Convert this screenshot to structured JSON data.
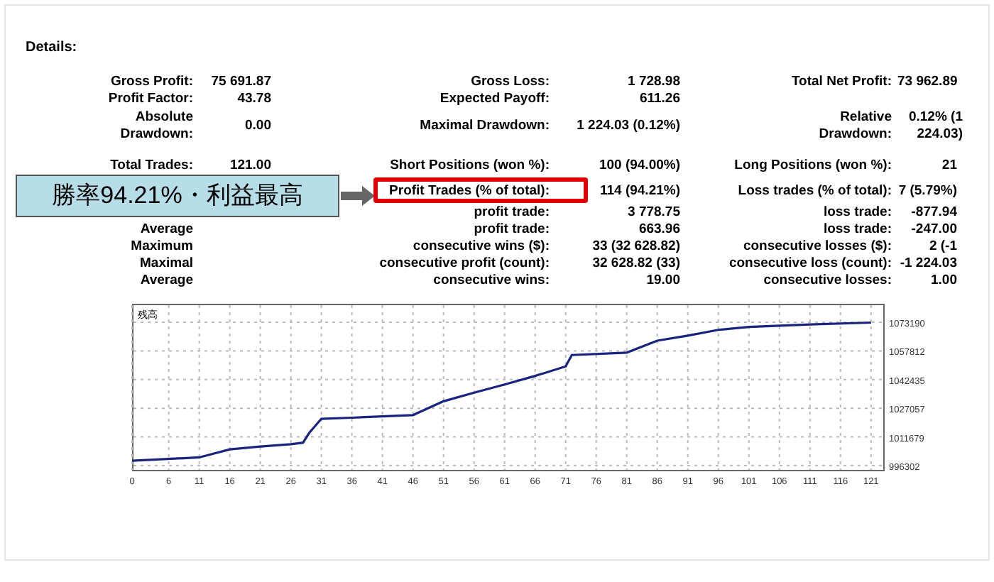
{
  "heading": "Details:",
  "stats": [
    {
      "left": {
        "label": "Gross Profit:",
        "value": "75 691.87"
      },
      "middle": {
        "label": "Gross Loss:",
        "value": "1 728.98"
      },
      "right": {
        "label": "Total Net Profit:",
        "value": "73 962.89"
      }
    },
    {
      "left": {
        "label": "Profit Factor:",
        "value": "43.78"
      },
      "middle": {
        "label": "Expected Payoff:",
        "value": "611.26"
      }
    },
    {
      "left": {
        "label": "Absolute Drawdown:",
        "value": "0.00"
      },
      "middle": {
        "label": "Maximal Drawdown:",
        "value": "1 224.03 (0.12%)"
      },
      "right": {
        "label": "Relative Drawdown:",
        "value": "0.12% (1 224.03)"
      }
    },
    {
      "left": {
        "label": "Total Trades:",
        "value": "121.00"
      },
      "middle": {
        "label": "Short Positions (won %):",
        "value": "100 (94.00%)"
      },
      "right": {
        "label": "Long Positions (won %):",
        "value": "21"
      }
    },
    {
      "middle": {
        "label": "Profit Trades (% of total):",
        "value": "114 (94.21%)"
      },
      "right": {
        "label": "Loss trades (% of total):",
        "value": "7 (5.79%)"
      }
    },
    {
      "middle": {
        "label": "profit trade:",
        "value": "3 778.75"
      },
      "right": {
        "label": "loss trade:",
        "value": "-877.94"
      }
    },
    {
      "left": {
        "label": "Average"
      },
      "middle": {
        "label": "profit trade:",
        "value": "663.96"
      },
      "right": {
        "label": "loss trade:",
        "value": "-247.00"
      }
    },
    {
      "left": {
        "label": "Maximum"
      },
      "middle": {
        "label": "consecutive wins ($):",
        "value": "33 (32 628.82)"
      },
      "right": {
        "label": "consecutive losses ($):",
        "value": "2 (-1"
      }
    },
    {
      "left": {
        "label": "Maximal"
      },
      "middle": {
        "label": "consecutive profit (count):",
        "value": "32 628.82 (33)"
      },
      "right": {
        "label": "consecutive loss (count):",
        "value": "-1 224.03"
      }
    },
    {
      "left": {
        "label": "Average"
      },
      "middle": {
        "label": "consecutive wins:",
        "value": "19.00"
      },
      "right": {
        "label": "consecutive losses:",
        "value": "1.00"
      }
    }
  ],
  "callout": {
    "text": "勝率94.21%・利益最高"
  },
  "chart": {
    "chart_data": {
      "type": "line",
      "title": "残高",
      "x": [
        0,
        11,
        16,
        21,
        26,
        28,
        29,
        31,
        36,
        46,
        51,
        56,
        61,
        66,
        71,
        72,
        81,
        86,
        91,
        96,
        101,
        111,
        121
      ],
      "grid": true,
      "series": [
        {
          "color": "#1a237e",
          "values": [
            998900,
            1000700,
            1005000,
            1006500,
            1007800,
            1008600,
            1013800,
            1021400,
            1022000,
            1023400,
            1030800,
            1035400,
            1039800,
            1044400,
            1049500,
            1055600,
            1056900,
            1063300,
            1066000,
            1069100,
            1070700,
            1072000,
            1073000
          ]
        }
      ],
      "xlim": [
        0,
        123
      ],
      "ylim": [
        996302,
        1073190
      ],
      "xticks": [
        0,
        6,
        11,
        16,
        21,
        26,
        31,
        36,
        41,
        46,
        51,
        56,
        61,
        66,
        71,
        76,
        81,
        86,
        91,
        96,
        101,
        106,
        111,
        116,
        121
      ],
      "yticks": [
        996302,
        1011679,
        1027057,
        1042435,
        1057812,
        1073190
      ]
    }
  }
}
